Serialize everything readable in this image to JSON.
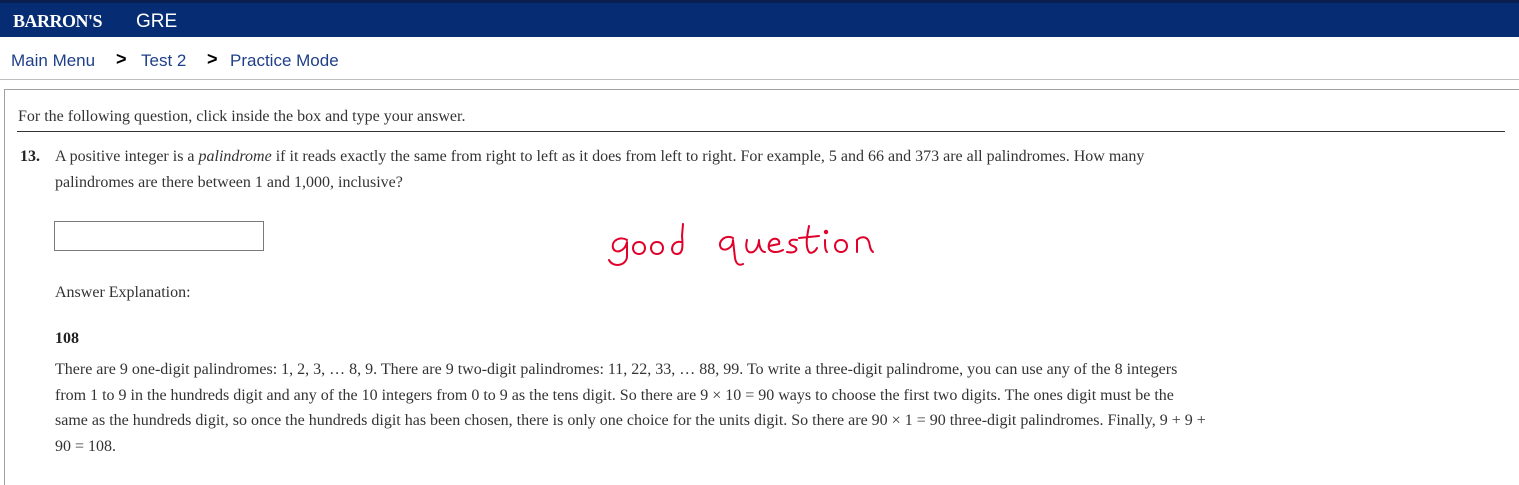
{
  "header": {
    "brand": "BARRON'S",
    "product": "GRE"
  },
  "breadcrumb": {
    "items": [
      "Main Menu",
      "Test 2",
      "Practice Mode"
    ],
    "separator": ">"
  },
  "instructions": "For the following question, click inside the box and type your answer.",
  "question": {
    "number": "13.",
    "line1_pre": "A positive integer is a ",
    "line1_em": "palindrome",
    "line1_post": " if it reads exactly the same from right to left as it does from left to right. For example, 5 and 66 and 373 are all palindromes. How many",
    "line2": "palindromes are there between 1 and 1,000, inclusive?"
  },
  "answer_input": {
    "value": "",
    "placeholder": ""
  },
  "annotation": "good question",
  "explanation": {
    "label": "Answer Explanation:",
    "answer": "108",
    "lines": [
      "There are 9 one-digit palindromes: 1, 2, 3, … 8, 9. There are 9 two-digit palindromes: 11, 22, 33, … 88, 99. To write a three-digit palindrome, you can use any of the 8 integers",
      "from 1 to 9 in the hundreds digit and any of the 10 integers from 0 to 9 as the tens digit. So there are 9 × 10 = 90 ways to choose the first two digits. The ones digit must be the",
      "same as the hundreds digit, so once the hundreds digit has been chosen, there is only one choice for the units digit. So there are 90 × 1 = 90 three-digit palindromes. Finally, 9 + 9 +",
      "90 = 108."
    ]
  },
  "colors": {
    "header_bg": "#062d73",
    "link": "#1f3f8a",
    "annotation": "#e0002a"
  }
}
